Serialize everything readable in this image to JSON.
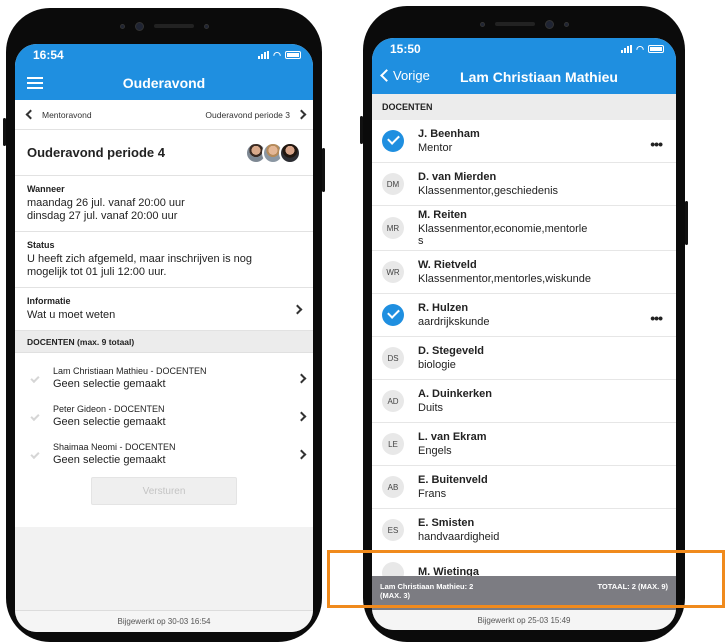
{
  "left": {
    "status_time": "16:54",
    "nav_title": "Ouderavond",
    "period_prev": "Mentoravond",
    "period_next": "Ouderavond periode 3",
    "event_title": "Ouderavond periode 4",
    "wanneer_label": "Wanneer",
    "wanneer_line1": "maandag 26 jul. vanaf 20:00 uur",
    "wanneer_line2": "dinsdag 27 jul. vanaf 20:00 uur",
    "status_label": "Status",
    "status_line1": "U heeft zich afgemeld, maar inschrijven is nog",
    "status_line2": "mogelijk tot 01 juli 12:00 uur.",
    "info_label": "Informatie",
    "info_value": "Wat u moet weten",
    "docenten_header": "DOCENTEN (max. 9 totaal)",
    "docenten": [
      {
        "name": "Lam Christiaan Mathieu - DOCENTEN",
        "selection": "Geen selectie gemaakt"
      },
      {
        "name": "Peter Gideon  - DOCENTEN",
        "selection": "Geen selectie gemaakt"
      },
      {
        "name": "Shaimaa Neomi  - DOCENTEN",
        "selection": "Geen selectie gemaakt"
      }
    ],
    "send_label": "Versturen",
    "updated": "Bijgewerkt op 30-03 16:54"
  },
  "right": {
    "status_time": "15:50",
    "back_label": "Vorige",
    "nav_title": "Lam Christiaan Mathieu",
    "section_header": "DOCENTEN",
    "teachers": [
      {
        "initials": "",
        "selected": true,
        "name": "J. Beenham",
        "role": "Mentor",
        "more": "•••"
      },
      {
        "initials": "DM",
        "selected": false,
        "name": "D. van Mierden",
        "role": "Klassenmentor,geschiedenis"
      },
      {
        "initials": "MR",
        "selected": false,
        "name": "M. Reiten",
        "role": "Klassenmentor,economie,mentorle",
        "role2": "s"
      },
      {
        "initials": "WR",
        "selected": false,
        "name": "W. Rietveld",
        "role": "Klassenmentor,mentorles,wiskunde"
      },
      {
        "initials": "",
        "selected": true,
        "name": "R. Hulzen",
        "role": "aardrijkskunde",
        "more": "•••"
      },
      {
        "initials": "DS",
        "selected": false,
        "name": "D. Stegeveld",
        "role": "biologie"
      },
      {
        "initials": "AD",
        "selected": false,
        "name": "A. Duinkerken",
        "role": "Duits"
      },
      {
        "initials": "LE",
        "selected": false,
        "name": "L. van Ekram",
        "role": "Engels"
      },
      {
        "initials": "AB",
        "selected": false,
        "name": "E. Buitenveld",
        "role": "Frans"
      },
      {
        "initials": "ES",
        "selected": false,
        "name": "E. Smisten",
        "role": "handvaardigheid"
      },
      {
        "initials": "",
        "selected": false,
        "name": "M. Wietinga",
        "role": ""
      }
    ],
    "summary_left_line1": "Lam Christiaan Mathieu: 2",
    "summary_left_line2": "(MAX. 3)",
    "summary_right": "TOTAAL: 2 (MAX. 9)",
    "updated": "Bijgewerkt op 25-03 15:49"
  },
  "colors": {
    "brand_blue": "#1f8fe0",
    "highlight_orange": "#f08a1c",
    "summary_gray": "#7c7c82"
  }
}
